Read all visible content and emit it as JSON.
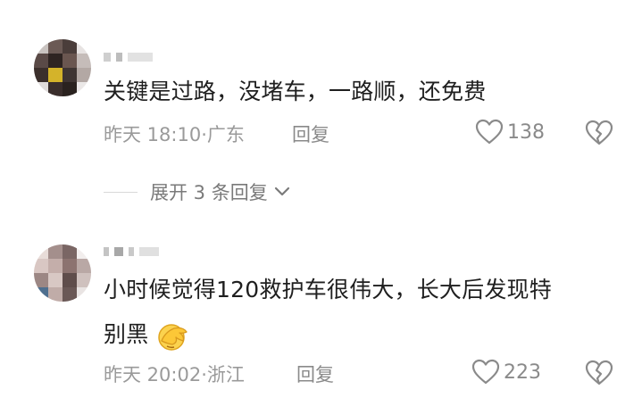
{
  "comments": [
    {
      "text_line1": "关键是过路，没堵车，一路顺，还免费",
      "time": "昨天 18:10",
      "location": "广东",
      "reply_label": "回复",
      "likes": "138",
      "expand_label": "展开 3 条回复"
    },
    {
      "text_line1": "小时候觉得120救护车很伟大，长大后发现特",
      "text_line2": "别黑",
      "emoji": "facepalm-emoji",
      "time": "昨天 20:02",
      "location": "浙江",
      "reply_label": "回复",
      "likes": "223"
    }
  ],
  "separator": "·",
  "colors": {
    "meta_text": "#9a9a9a",
    "body_text": "#1f1f1f",
    "icon_gray": "#8a8a8a"
  },
  "icons": [
    "heart-icon",
    "broken-heart-icon",
    "chevron-down-icon"
  ]
}
